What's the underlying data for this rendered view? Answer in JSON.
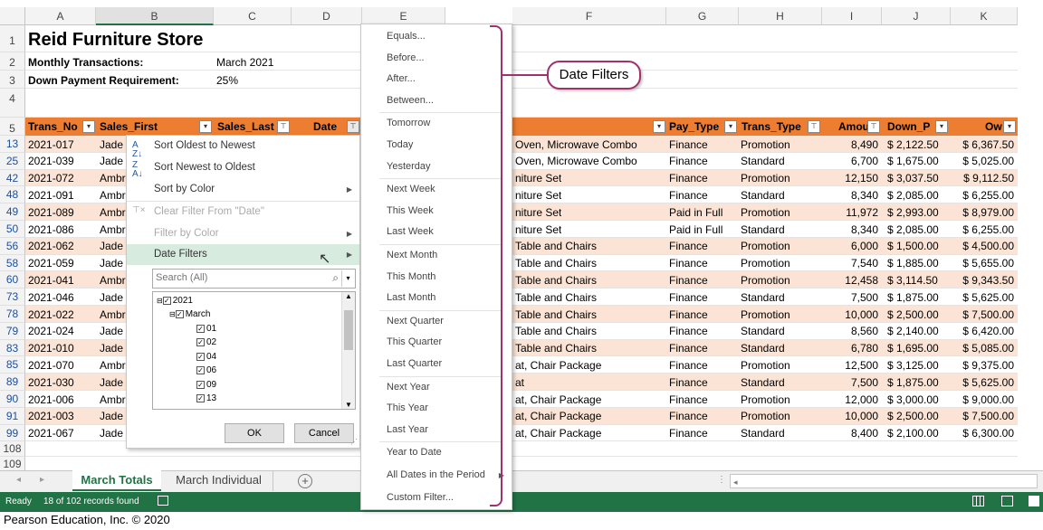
{
  "columns": [
    "A",
    "B",
    "C",
    "D",
    "E",
    "F",
    "G",
    "H",
    "I",
    "J",
    "K"
  ],
  "title": "Reid Furniture Store",
  "info": {
    "row2_label": "Monthly Transactions:",
    "row2_value": "March 2021",
    "row3_label": "Down Payment Requirement:",
    "row3_value": "25%"
  },
  "row_numbers_top": [
    "1",
    "2",
    "3",
    "4",
    "5"
  ],
  "headers": {
    "a": "Trans_No",
    "b": "Sales_First",
    "c": "Sales_Last",
    "d": "Date",
    "f": "",
    "g": "Pay_Type",
    "h": "Trans_Type",
    "i": "Amou",
    "j": "Down_P",
    "k": "Ow"
  },
  "rows": [
    {
      "n": "13",
      "a": "2021-017",
      "b": "Jade",
      "f": "Oven, Microwave Combo",
      "g": "Finance",
      "h": "Promotion",
      "i": "8,490",
      "j": "$ 2,122.50",
      "k": "$ 6,367.50",
      "p": true
    },
    {
      "n": "25",
      "a": "2021-039",
      "b": "Jade",
      "f": "Oven, Microwave Combo",
      "g": "Finance",
      "h": "Standard",
      "i": "6,700",
      "j": "$ 1,675.00",
      "k": "$ 5,025.00",
      "p": false
    },
    {
      "n": "42",
      "a": "2021-072",
      "b": "Ambr",
      "f": "niture Set",
      "g": "Finance",
      "h": "Promotion",
      "i": "12,150",
      "j": "$ 3,037.50",
      "k": "$ 9,112.50",
      "p": true
    },
    {
      "n": "48",
      "a": "2021-091",
      "b": "Ambr",
      "f": "niture Set",
      "g": "Finance",
      "h": "Standard",
      "i": "8,340",
      "j": "$ 2,085.00",
      "k": "$ 6,255.00",
      "p": false
    },
    {
      "n": "49",
      "a": "2021-089",
      "b": "Ambr",
      "f": "niture Set",
      "g": "Paid in Full",
      "h": "Promotion",
      "i": "11,972",
      "j": "$ 2,993.00",
      "k": "$ 8,979.00",
      "p": true
    },
    {
      "n": "50",
      "a": "2021-086",
      "b": "Ambr",
      "f": "niture Set",
      "g": "Paid in Full",
      "h": "Standard",
      "i": "8,340",
      "j": "$ 2,085.00",
      "k": "$ 6,255.00",
      "p": false
    },
    {
      "n": "56",
      "a": "2021-062",
      "b": "Jade",
      "f": "Table and Chairs",
      "g": "Finance",
      "h": "Promotion",
      "i": "6,000",
      "j": "$ 1,500.00",
      "k": "$ 4,500.00",
      "p": true
    },
    {
      "n": "58",
      "a": "2021-059",
      "b": "Jade",
      "f": "Table and Chairs",
      "g": "Finance",
      "h": "Promotion",
      "i": "7,540",
      "j": "$ 1,885.00",
      "k": "$ 5,655.00",
      "p": false
    },
    {
      "n": "60",
      "a": "2021-041",
      "b": "Ambr",
      "f": "Table and Chairs",
      "g": "Finance",
      "h": "Promotion",
      "i": "12,458",
      "j": "$ 3,114.50",
      "k": "$ 9,343.50",
      "p": true
    },
    {
      "n": "73",
      "a": "2021-046",
      "b": "Jade",
      "f": "Table and Chairs",
      "g": "Finance",
      "h": "Standard",
      "i": "7,500",
      "j": "$ 1,875.00",
      "k": "$ 5,625.00",
      "p": false
    },
    {
      "n": "78",
      "a": "2021-022",
      "b": "Ambr",
      "f": "Table and Chairs",
      "g": "Finance",
      "h": "Promotion",
      "i": "10,000",
      "j": "$ 2,500.00",
      "k": "$ 7,500.00",
      "p": true
    },
    {
      "n": "79",
      "a": "2021-024",
      "b": "Jade",
      "f": "Table and Chairs",
      "g": "Finance",
      "h": "Standard",
      "i": "8,560",
      "j": "$ 2,140.00",
      "k": "$ 6,420.00",
      "p": false
    },
    {
      "n": "83",
      "a": "2021-010",
      "b": "Jade",
      "f": "Table and Chairs",
      "g": "Finance",
      "h": "Standard",
      "i": "6,780",
      "j": "$ 1,695.00",
      "k": "$ 5,085.00",
      "p": true
    },
    {
      "n": "85",
      "a": "2021-070",
      "b": "Ambr",
      "f": "at, Chair Package",
      "g": "Finance",
      "h": "Promotion",
      "i": "12,500",
      "j": "$ 3,125.00",
      "k": "$ 9,375.00",
      "p": false
    },
    {
      "n": "89",
      "a": "2021-030",
      "b": "Jade",
      "f": "at",
      "g": "Finance",
      "h": "Standard",
      "i": "7,500",
      "j": "$ 1,875.00",
      "k": "$ 5,625.00",
      "p": true
    },
    {
      "n": "90",
      "a": "2021-006",
      "b": "Ambr",
      "f": "at, Chair Package",
      "g": "Finance",
      "h": "Promotion",
      "i": "12,000",
      "j": "$ 3,000.00",
      "k": "$ 9,000.00",
      "p": false
    },
    {
      "n": "91",
      "a": "2021-003",
      "b": "Jade",
      "f": "at, Chair Package",
      "g": "Finance",
      "h": "Promotion",
      "i": "10,000",
      "j": "$ 2,500.00",
      "k": "$ 7,500.00",
      "p": true
    },
    {
      "n": "99",
      "a": "2021-067",
      "b": "Jade",
      "f": "at, Chair Package",
      "g": "Finance",
      "h": "Standard",
      "i": "8,400",
      "j": "$ 2,100.00",
      "k": "$ 6,300.00",
      "p": false
    }
  ],
  "row_numbers_bottom": [
    "108",
    "109"
  ],
  "filter_menu": {
    "items": [
      "Sort Oldest to Newest",
      "Sort Newest to Oldest",
      "Sort by Color",
      "Clear Filter From \"Date\"",
      "Filter by Color",
      "Date Filters"
    ],
    "search_placeholder": "Search (All)",
    "tree": [
      "2021",
      "March",
      "01",
      "02",
      "04",
      "06",
      "09",
      "13"
    ],
    "ok": "OK",
    "cancel": "Cancel"
  },
  "submenu": [
    "Equals...",
    "Before...",
    "After...",
    "Between...",
    "Tomorrow",
    "Today",
    "Yesterday",
    "Next Week",
    "This Week",
    "Last Week",
    "Next Month",
    "This Month",
    "Last Month",
    "Next Quarter",
    "This Quarter",
    "Last Quarter",
    "Next Year",
    "This Year",
    "Last Year",
    "Year to Date",
    "All Dates in the Period",
    "Custom Filter..."
  ],
  "callout": "Date Filters",
  "sheet_tabs": [
    "March Totals",
    "March Individual"
  ],
  "status": {
    "ready": "Ready",
    "records": "18 of 102 records found"
  },
  "copyright": "Pearson Education, Inc. © 2020",
  "colors": {
    "header_orange": "#ed7d31",
    "band_peach": "#fbe4d5",
    "status_green": "#217346",
    "callout_border": "#a0306e"
  }
}
